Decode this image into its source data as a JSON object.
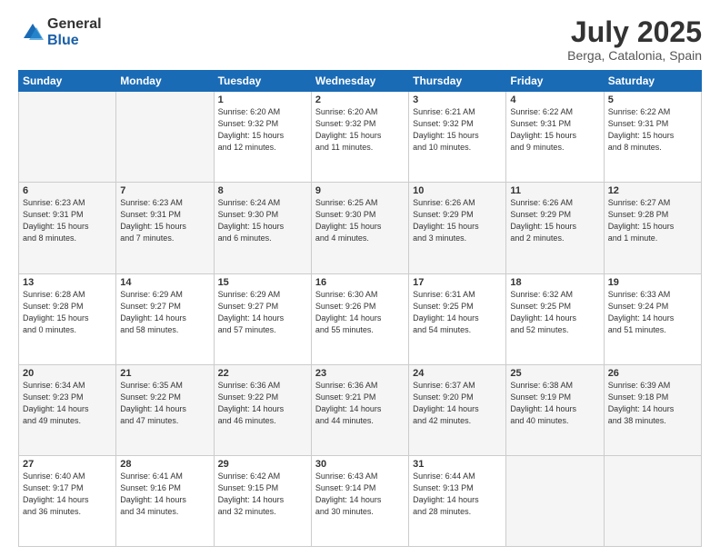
{
  "header": {
    "logo_general": "General",
    "logo_blue": "Blue",
    "month_year": "July 2025",
    "location": "Berga, Catalonia, Spain"
  },
  "weekdays": [
    "Sunday",
    "Monday",
    "Tuesday",
    "Wednesday",
    "Thursday",
    "Friday",
    "Saturday"
  ],
  "weeks": [
    [
      {
        "day": "",
        "info": ""
      },
      {
        "day": "",
        "info": ""
      },
      {
        "day": "1",
        "info": "Sunrise: 6:20 AM\nSunset: 9:32 PM\nDaylight: 15 hours\nand 12 minutes."
      },
      {
        "day": "2",
        "info": "Sunrise: 6:20 AM\nSunset: 9:32 PM\nDaylight: 15 hours\nand 11 minutes."
      },
      {
        "day": "3",
        "info": "Sunrise: 6:21 AM\nSunset: 9:32 PM\nDaylight: 15 hours\nand 10 minutes."
      },
      {
        "day": "4",
        "info": "Sunrise: 6:22 AM\nSunset: 9:31 PM\nDaylight: 15 hours\nand 9 minutes."
      },
      {
        "day": "5",
        "info": "Sunrise: 6:22 AM\nSunset: 9:31 PM\nDaylight: 15 hours\nand 8 minutes."
      }
    ],
    [
      {
        "day": "6",
        "info": "Sunrise: 6:23 AM\nSunset: 9:31 PM\nDaylight: 15 hours\nand 8 minutes."
      },
      {
        "day": "7",
        "info": "Sunrise: 6:23 AM\nSunset: 9:31 PM\nDaylight: 15 hours\nand 7 minutes."
      },
      {
        "day": "8",
        "info": "Sunrise: 6:24 AM\nSunset: 9:30 PM\nDaylight: 15 hours\nand 6 minutes."
      },
      {
        "day": "9",
        "info": "Sunrise: 6:25 AM\nSunset: 9:30 PM\nDaylight: 15 hours\nand 4 minutes."
      },
      {
        "day": "10",
        "info": "Sunrise: 6:26 AM\nSunset: 9:29 PM\nDaylight: 15 hours\nand 3 minutes."
      },
      {
        "day": "11",
        "info": "Sunrise: 6:26 AM\nSunset: 9:29 PM\nDaylight: 15 hours\nand 2 minutes."
      },
      {
        "day": "12",
        "info": "Sunrise: 6:27 AM\nSunset: 9:28 PM\nDaylight: 15 hours\nand 1 minute."
      }
    ],
    [
      {
        "day": "13",
        "info": "Sunrise: 6:28 AM\nSunset: 9:28 PM\nDaylight: 15 hours\nand 0 minutes."
      },
      {
        "day": "14",
        "info": "Sunrise: 6:29 AM\nSunset: 9:27 PM\nDaylight: 14 hours\nand 58 minutes."
      },
      {
        "day": "15",
        "info": "Sunrise: 6:29 AM\nSunset: 9:27 PM\nDaylight: 14 hours\nand 57 minutes."
      },
      {
        "day": "16",
        "info": "Sunrise: 6:30 AM\nSunset: 9:26 PM\nDaylight: 14 hours\nand 55 minutes."
      },
      {
        "day": "17",
        "info": "Sunrise: 6:31 AM\nSunset: 9:25 PM\nDaylight: 14 hours\nand 54 minutes."
      },
      {
        "day": "18",
        "info": "Sunrise: 6:32 AM\nSunset: 9:25 PM\nDaylight: 14 hours\nand 52 minutes."
      },
      {
        "day": "19",
        "info": "Sunrise: 6:33 AM\nSunset: 9:24 PM\nDaylight: 14 hours\nand 51 minutes."
      }
    ],
    [
      {
        "day": "20",
        "info": "Sunrise: 6:34 AM\nSunset: 9:23 PM\nDaylight: 14 hours\nand 49 minutes."
      },
      {
        "day": "21",
        "info": "Sunrise: 6:35 AM\nSunset: 9:22 PM\nDaylight: 14 hours\nand 47 minutes."
      },
      {
        "day": "22",
        "info": "Sunrise: 6:36 AM\nSunset: 9:22 PM\nDaylight: 14 hours\nand 46 minutes."
      },
      {
        "day": "23",
        "info": "Sunrise: 6:36 AM\nSunset: 9:21 PM\nDaylight: 14 hours\nand 44 minutes."
      },
      {
        "day": "24",
        "info": "Sunrise: 6:37 AM\nSunset: 9:20 PM\nDaylight: 14 hours\nand 42 minutes."
      },
      {
        "day": "25",
        "info": "Sunrise: 6:38 AM\nSunset: 9:19 PM\nDaylight: 14 hours\nand 40 minutes."
      },
      {
        "day": "26",
        "info": "Sunrise: 6:39 AM\nSunset: 9:18 PM\nDaylight: 14 hours\nand 38 minutes."
      }
    ],
    [
      {
        "day": "27",
        "info": "Sunrise: 6:40 AM\nSunset: 9:17 PM\nDaylight: 14 hours\nand 36 minutes."
      },
      {
        "day": "28",
        "info": "Sunrise: 6:41 AM\nSunset: 9:16 PM\nDaylight: 14 hours\nand 34 minutes."
      },
      {
        "day": "29",
        "info": "Sunrise: 6:42 AM\nSunset: 9:15 PM\nDaylight: 14 hours\nand 32 minutes."
      },
      {
        "day": "30",
        "info": "Sunrise: 6:43 AM\nSunset: 9:14 PM\nDaylight: 14 hours\nand 30 minutes."
      },
      {
        "day": "31",
        "info": "Sunrise: 6:44 AM\nSunset: 9:13 PM\nDaylight: 14 hours\nand 28 minutes."
      },
      {
        "day": "",
        "info": ""
      },
      {
        "day": "",
        "info": ""
      }
    ]
  ]
}
